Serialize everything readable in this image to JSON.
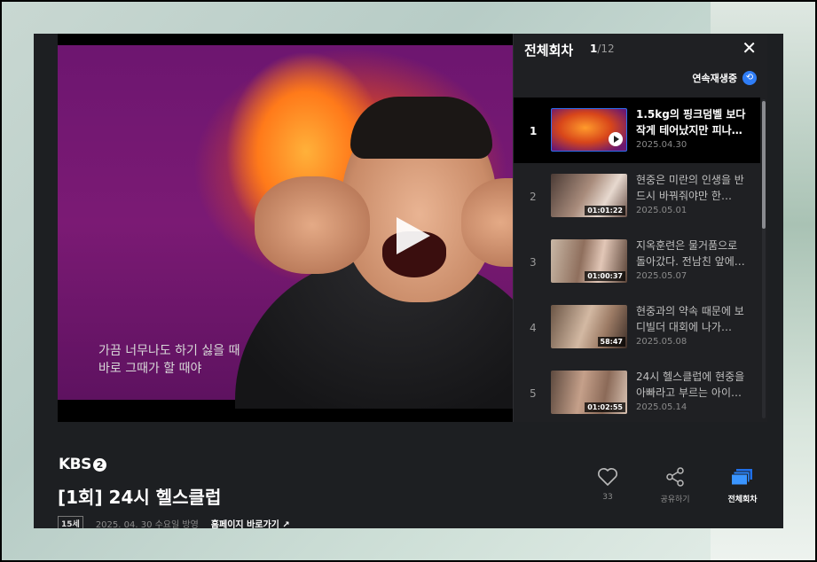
{
  "video": {
    "subtitle_line1": "가끔 너무나도 하기 싫을 때",
    "subtitle_line2": "바로 그때가 할 때야"
  },
  "panel": {
    "title": "전체회차",
    "current": "1",
    "total": "/12",
    "close": "✕",
    "autoplay_label": "연속재생중",
    "autoplay_icon": "⟲"
  },
  "episodes": [
    {
      "num": "1",
      "title": "1.5kg의 핑크덤벨 보다 작게 테어났지만 피나…",
      "date": "2025.04.30",
      "duration": ""
    },
    {
      "num": "2",
      "title": "현중은 미란의 인생을 반드시 바꿔줘야만 한…",
      "date": "2025.05.01",
      "duration": "01:01:22"
    },
    {
      "num": "3",
      "title": "지옥훈련은 물거품으로 돌아갔다. 전남친 앞에…",
      "date": "2025.05.07",
      "duration": "01:00:37"
    },
    {
      "num": "4",
      "title": "현중과의 약속 때문에 보디빌더 대회에 나가…",
      "date": "2025.05.08",
      "duration": "58:47"
    },
    {
      "num": "5",
      "title": "24시 헬스클럽에 현중을 아빠라고 부르는 아이…",
      "date": "2025.05.14",
      "duration": "01:02:55"
    }
  ],
  "program": {
    "logo_text": "KBS",
    "logo_mark": "2",
    "title": "[1회] 24시 헬스클럽",
    "age": "15세",
    "air_info": "2025. 04. 30 수요일 방영",
    "homepage_link": "홈페이지 바로가기 ↗"
  },
  "actions": {
    "like_count": "33",
    "share_label": "공유하기",
    "episodes_label": "전체회차"
  }
}
